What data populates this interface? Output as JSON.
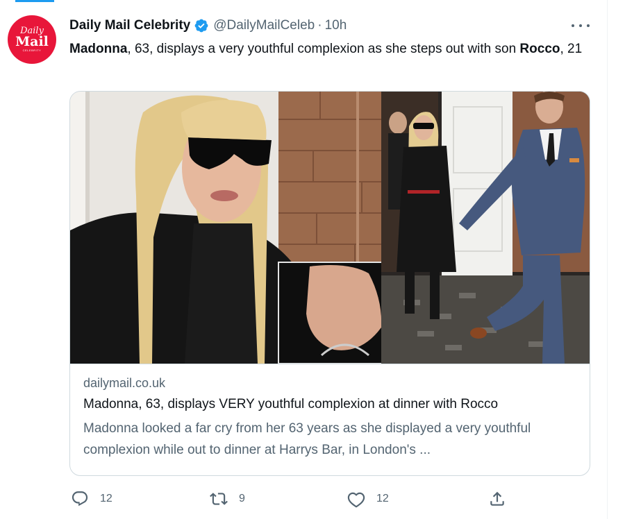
{
  "tweet": {
    "author": {
      "avatar": {
        "line1": "Daily",
        "line2": "Mail",
        "line3": "CELEBRITY"
      },
      "name": "Daily Mail Celebrity",
      "verified": true,
      "handle": "@DailyMailCeleb",
      "separator": "·",
      "time": "10h"
    },
    "more_icon": "more-horizontal-icon",
    "text": {
      "p1": "Madonna",
      "p2": ", 63, displays a very youthful complexion as she steps out with son ",
      "p3": "Rocco",
      "p4": ", 21"
    },
    "card": {
      "image_alt": "Madonna wearing dark sunglasses and a black outfit, with an inset close-up of her hand, walking out of a restaurant with son Rocco in a blue suit",
      "domain": "dailymail.co.uk",
      "title": "Madonna, 63, displays VERY youthful complexion at dinner with Rocco",
      "description": "Madonna looked a far cry from her 63 years as she displayed a very youthful complexion while out to dinner at Harrys Bar, in London's ..."
    },
    "actions": {
      "reply": {
        "icon": "reply-icon",
        "count": "12"
      },
      "retweet": {
        "icon": "retweet-icon",
        "count": "9"
      },
      "like": {
        "icon": "heart-icon",
        "count": "12"
      },
      "share": {
        "icon": "share-icon"
      }
    },
    "colors": {
      "accent": "#1d9bf0",
      "brand": "#e8163a",
      "muted": "#536471",
      "border": "#cfd9de"
    }
  }
}
